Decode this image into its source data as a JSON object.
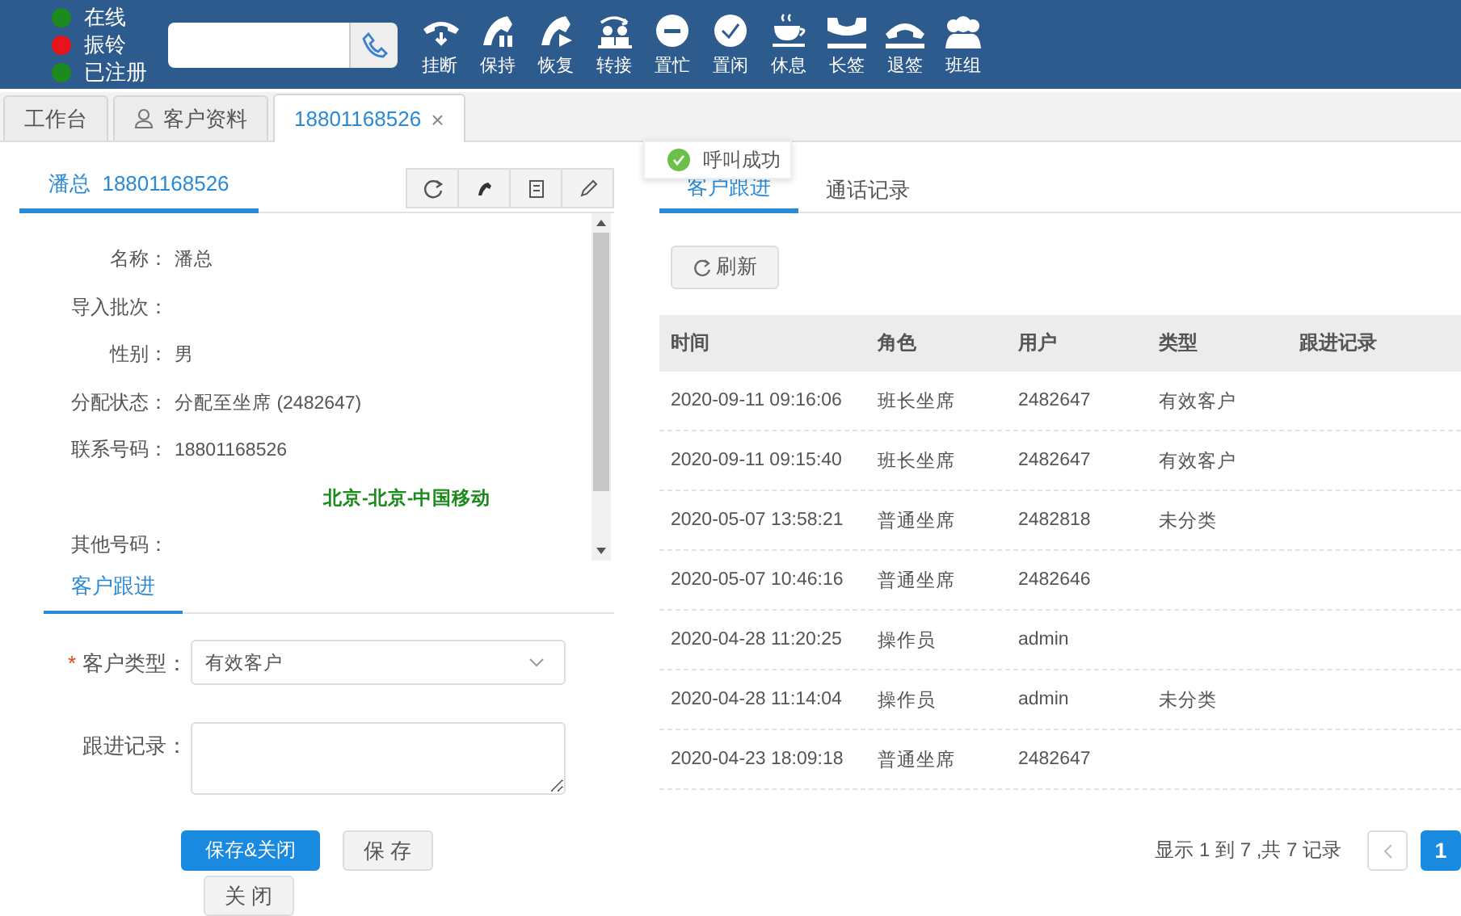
{
  "toolbar": {
    "statuses": [
      {
        "label": "在线",
        "color": "#1d8a1d"
      },
      {
        "label": "振铃",
        "color": "#e8141c"
      },
      {
        "label": "已注册",
        "color": "#1d8a1d"
      }
    ],
    "actions": [
      "挂断",
      "保持",
      "恢复",
      "转接",
      "置忙",
      "置闲",
      "休息",
      "长签",
      "退签",
      "班组"
    ]
  },
  "tabs": [
    {
      "label": "工作台",
      "selected": false
    },
    {
      "label": "客户资料",
      "selected": false
    },
    {
      "label": "18801168526",
      "selected": true,
      "close": "×"
    }
  ],
  "toast": {
    "text": "呼叫成功"
  },
  "customer": {
    "tab": "潘总  18801168526",
    "fields": [
      {
        "label": "名称：",
        "value": "潘总"
      },
      {
        "label": "导入批次："
      },
      {
        "label": "性别：",
        "value": "男"
      },
      {
        "label": "分配状态：",
        "value": "分配至坐席 (2482647)"
      },
      {
        "label": "联系号码：",
        "value": "18801168526"
      },
      {
        "kind": "location",
        "value": "北京-北京-中国移动"
      },
      {
        "label": "其他号码："
      }
    ]
  },
  "followup": {
    "tab": "客户跟进",
    "type_field": {
      "required_mark": "*",
      "label": "客户类型：",
      "value": "有效客户"
    },
    "note_field": {
      "label": "跟进记录："
    },
    "buttons": [
      {
        "label": "保存&关闭",
        "kind": "primary"
      },
      {
        "label": "保 存",
        "kind": "default"
      },
      {
        "label": "关 闭",
        "kind": "default"
      }
    ]
  },
  "record_tabs": [
    {
      "label": "客户跟进",
      "selected": true
    },
    {
      "label": "通话记录",
      "selected": false
    }
  ],
  "refresh_button": "刷新",
  "table": {
    "columns": [
      "时间",
      "角色",
      "用户",
      "类型",
      "跟进记录"
    ],
    "rows": [
      [
        "2020-09-11 09:16:06",
        "班长坐席",
        "2482647",
        "有效客户"
      ],
      [
        "2020-09-11 09:15:40",
        "班长坐席",
        "2482647",
        "有效客户"
      ],
      [
        "2020-05-07 13:58:21",
        "普通坐席",
        "2482818",
        "未分类"
      ],
      [
        "2020-05-07 10:46:16",
        "普通坐席",
        "2482646"
      ],
      [
        "2020-04-28 11:20:25",
        "操作员",
        "admin"
      ],
      [
        "2020-04-28 11:14:04",
        "操作员",
        "admin",
        "未分类"
      ],
      [
        "2020-04-23 18:09:18",
        "普通坐席",
        "2482647"
      ]
    ]
  },
  "pagination": {
    "summary": "显示 1 到 7 ,共 7 记录",
    "pages": [
      {
        "label": "1",
        "selected": true
      }
    ]
  }
}
